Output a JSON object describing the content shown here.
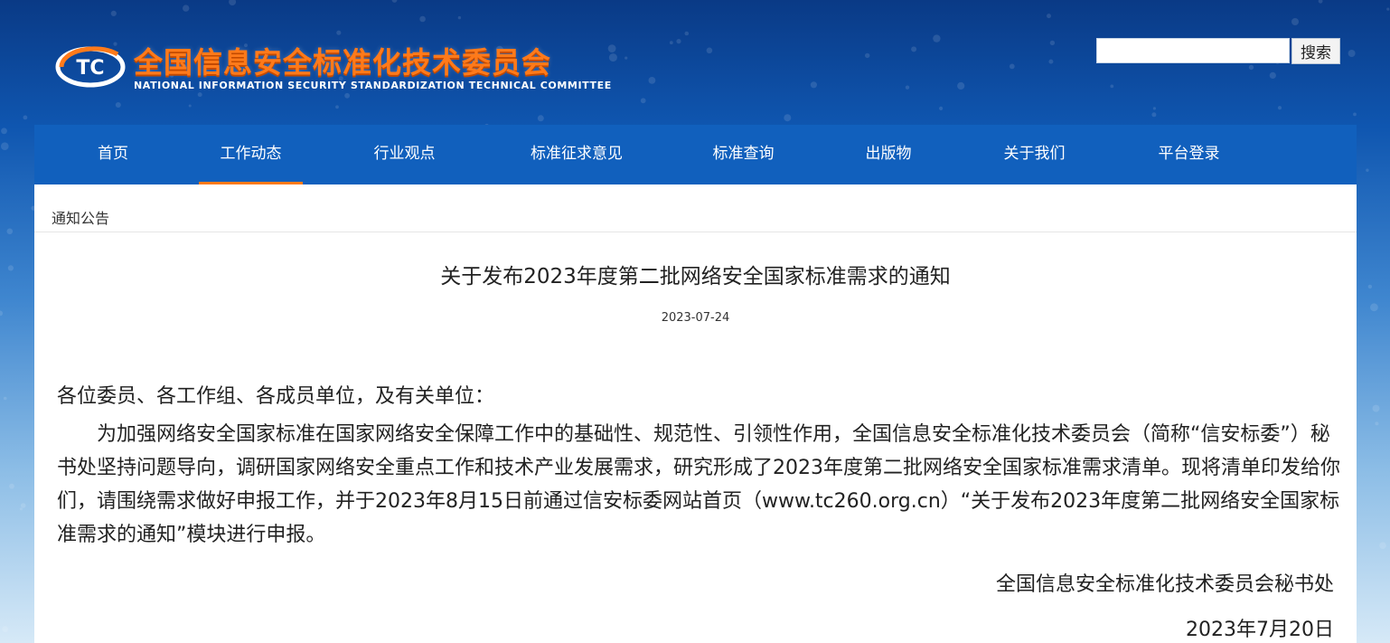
{
  "header": {
    "org_name_cn": "全国信息安全标准化技术委员会",
    "org_name_en": "NATIONAL INFORMATION SECURITY STANDARDIZATION TECHNICAL COMMITTEE",
    "logo_mark_text": "TC"
  },
  "search": {
    "input_value": "",
    "button_label": "搜索"
  },
  "nav": {
    "active_index": 1,
    "items": [
      "首页",
      "工作动态",
      "行业观点",
      "标准征求意见",
      "标准查询",
      "出版物",
      "关于我们",
      "平台登录"
    ]
  },
  "breadcrumb": {
    "label": "通知公告"
  },
  "article": {
    "title": "关于发布2023年度第二批网络安全国家标准需求的通知",
    "date": "2023-07-24",
    "salutation": "各位委员、各工作组、各成员单位，及有关单位：",
    "paragraph": "为加强网络安全国家标准在国家网络安全保障工作中的基础性、规范性、引领性作用，全国信息安全标准化技术委员会（简称“信安标委”）秘书处坚持问题导向，调研国家网络安全重点工作和技术产业发展需求，研究形成了2023年度第二批网络安全国家标准需求清单。现将清单印发给你们，请围绕需求做好申报工作，并于2023年8月15日前通过信安标委网站首页（www.tc260.org.cn）“关于发布2023年度第二批网络安全国家标准需求的通知”模块进行申报。",
    "signature_org": "全国信息安全标准化技术委员会秘书处",
    "signature_date": "2023年7月20日"
  },
  "colors": {
    "nav_bg": "#1160bd",
    "accent": "#ff7a1a",
    "header_bg": "#0a3a86"
  }
}
